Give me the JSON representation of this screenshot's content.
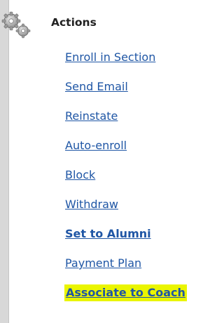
{
  "panel": {
    "title": "Actions",
    "icon": "gears-icon"
  },
  "actions": [
    {
      "label": "Enroll in Section",
      "name": "enroll-in-section-link",
      "style": "normal"
    },
    {
      "label": "Send Email",
      "name": "send-email-link",
      "style": "normal"
    },
    {
      "label": "Reinstate",
      "name": "reinstate-link",
      "style": "normal"
    },
    {
      "label": "Auto-enroll",
      "name": "auto-enroll-link",
      "style": "normal"
    },
    {
      "label": "Block",
      "name": "block-link",
      "style": "normal"
    },
    {
      "label": "Withdraw",
      "name": "withdraw-link",
      "style": "normal"
    },
    {
      "label": "Set to Alumni",
      "name": "set-to-alumni-link",
      "style": "bold"
    },
    {
      "label": "Payment Plan",
      "name": "payment-plan-link",
      "style": "normal"
    },
    {
      "label": "Associate to Coach",
      "name": "associate-to-coach-link",
      "style": "highlighted"
    }
  ],
  "colors": {
    "link": "#1f56a5",
    "highlight": "#eaf500",
    "rail": "#d8d8d8",
    "title": "#222222"
  }
}
